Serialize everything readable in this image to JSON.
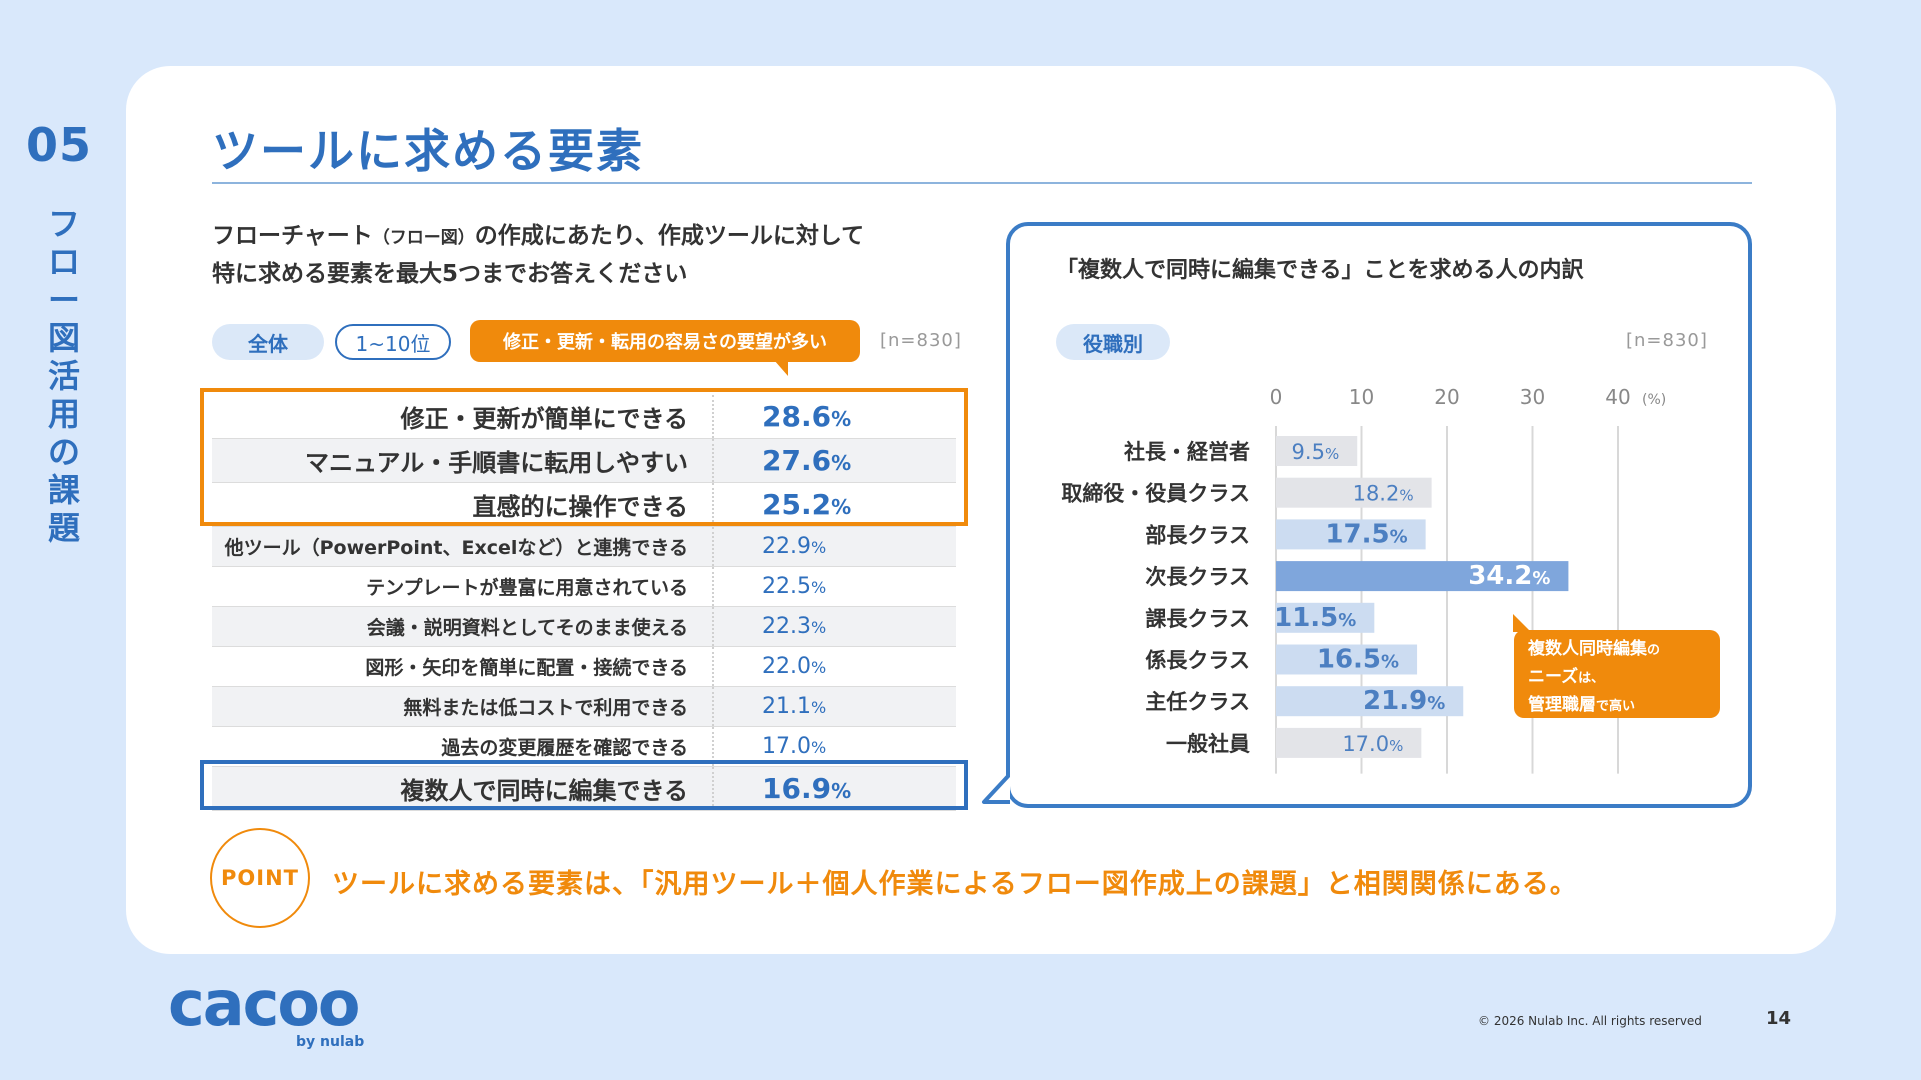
{
  "section": {
    "number": "05",
    "name": "フロー図活用の課題"
  },
  "page_title": "ツールに求める要素",
  "question": {
    "line1_a": "フローチャート",
    "line1_small": "（フロー図）",
    "line1_b": "の作成にあたり、作成ツールに対して",
    "line2": "特に求める要素を最大5つまでお答えください"
  },
  "filters": {
    "all": "全体",
    "rank": "1~10位"
  },
  "callout_top": "修正・更新・転用の容易さの要望が多い",
  "n_left": "[n=830]",
  "ranking": [
    {
      "label": "修正・更新が簡単にできる",
      "value": "28.6",
      "unit": "%"
    },
    {
      "label": "マニュアル・手順書に転用しやすい",
      "value": "27.6",
      "unit": "%"
    },
    {
      "label": "直感的に操作できる",
      "value": "25.2",
      "unit": "%"
    },
    {
      "label": "他ツール（PowerPoint、Excelなど）と連携できる",
      "value": "22.9",
      "unit": "%"
    },
    {
      "label": "テンプレートが豊富に用意されている",
      "value": "22.5",
      "unit": "%"
    },
    {
      "label": "会議・説明資料としてそのまま使える",
      "value": "22.3",
      "unit": "%"
    },
    {
      "label": "図形・矢印を簡単に配置・接続できる",
      "value": "22.0",
      "unit": "%"
    },
    {
      "label": "無料または低コストで利用できる",
      "value": "21.1",
      "unit": "%"
    },
    {
      "label": "過去の変更履歴を確認できる",
      "value": "17.0",
      "unit": "%"
    },
    {
      "label": "複数人で同時に編集できる",
      "value": "16.9",
      "unit": "%"
    }
  ],
  "panel": {
    "title": "「複数人で同時に編集できる」ことを求める人の内訳",
    "filter": "役職別",
    "n": "[n=830]"
  },
  "chart_data": {
    "type": "bar",
    "orientation": "horizontal",
    "categories": [
      "社長・経営者",
      "取締役・役員クラス",
      "部長クラス",
      "次長クラス",
      "課長クラス",
      "係長クラス",
      "主任クラス",
      "一般社員"
    ],
    "values": [
      9.5,
      18.2,
      17.5,
      34.2,
      11.5,
      16.5,
      21.9,
      17.0
    ],
    "value_labels": [
      "9.5",
      "18.2",
      "17.5",
      "34.2",
      "11.5",
      "16.5",
      "21.9",
      "17.0"
    ],
    "label_unit": "%",
    "xlim": [
      0,
      40
    ],
    "x_ticks": [
      "0",
      "10",
      "20",
      "30",
      "40"
    ],
    "x_unit": "(%)",
    "grid": true,
    "colors": {
      "dark": "#7fa6dc",
      "mid": "#ccdcf1",
      "gray": "#e3e4e8",
      "label_dark": "#ffffff",
      "label_light": "#4c7fc1"
    },
    "bar_colors": [
      "gray",
      "gray",
      "mid",
      "dark",
      "mid",
      "mid",
      "mid",
      "gray"
    ]
  },
  "callout_right": {
    "line1_a": "複数人同時編集",
    "line1_b": "の",
    "line2_a": "ニーズ",
    "line2_b": "は、",
    "line3_a": "管理職層",
    "line3_b": "で高い"
  },
  "point": {
    "badge": "POINT",
    "text": "ツールに求める要素は、「汎用ツール＋個人作業によるフロー図作成上の課題」と相関関係にある。"
  },
  "footer": {
    "logo": "cacoo",
    "logo_sub": "by nulab",
    "copyright": "© 2026 Nulab Inc. All rights reserved",
    "page": "14"
  },
  "theme": {
    "accent": "#2f6fbd",
    "orange": "#f08a0c",
    "bg": "#d9e8fb"
  }
}
